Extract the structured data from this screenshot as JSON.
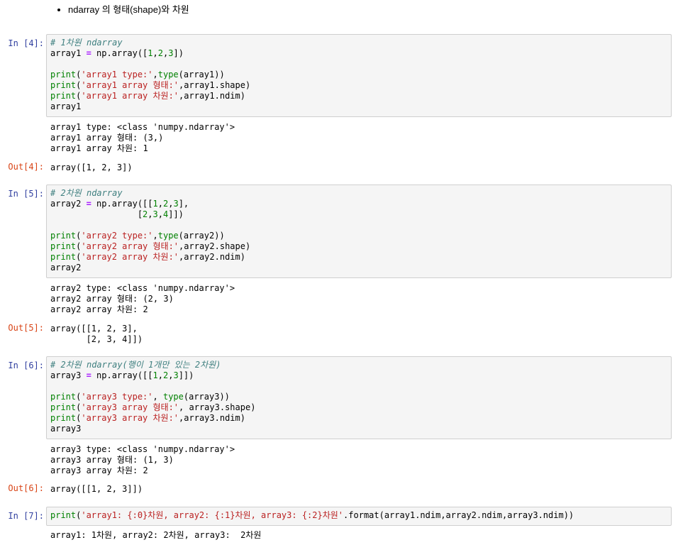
{
  "markdown": {
    "bullet": "ndarray 의 형태(shape)와 차원"
  },
  "cells": {
    "c4": {
      "in_prompt": "In [4]:",
      "out_prompt": "Out[4]:",
      "code": {
        "l1": "# 1차원 ndarray",
        "l2a": "array1 ",
        "l2b": "=",
        "l2c": " np.array([",
        "l2d": "1",
        "l2e": ",",
        "l2f": "2",
        "l2g": ",",
        "l2h": "3",
        "l2i": "])",
        "l4a": "print",
        "l4b": "(",
        "l4c": "'array1 type:'",
        "l4d": ",",
        "l4e": "type",
        "l4f": "(array1))",
        "l5a": "print",
        "l5b": "(",
        "l5c": "'array1 array 형태:'",
        "l5d": ",array1.shape)",
        "l6a": "print",
        "l6b": "(",
        "l6c": "'array1 array 차원:'",
        "l6d": ",array1.ndim)",
        "l7": "array1"
      },
      "stdout": [
        "array1 type: <class 'numpy.ndarray'>",
        "array1 array 형태: (3,)",
        "array1 array 차원: 1"
      ],
      "result": [
        "array([1, 2, 3])"
      ]
    },
    "c5": {
      "in_prompt": "In [5]:",
      "out_prompt": "Out[5]:",
      "code": {
        "l1": "# 2차원 ndarray",
        "l2a": "array2 ",
        "l2b": "=",
        "l2c": " np.array([[",
        "l2d": "1",
        "l2e": ",",
        "l2f": "2",
        "l2g": ",",
        "l2h": "3",
        "l2i": "],",
        "l3a": "                 [",
        "l3b": "2",
        "l3c": ",",
        "l3d": "3",
        "l3e": ",",
        "l3f": "4",
        "l3g": "]])",
        "l5a": "print",
        "l5b": "(",
        "l5c": "'array2 type:'",
        "l5d": ",",
        "l5e": "type",
        "l5f": "(array2))",
        "l6a": "print",
        "l6b": "(",
        "l6c": "'array2 array 형태:'",
        "l6d": ",array2.shape)",
        "l7a": "print",
        "l7b": "(",
        "l7c": "'array2 array 차원:'",
        "l7d": ",array2.ndim)",
        "l8": "array2"
      },
      "stdout": [
        "array2 type: <class 'numpy.ndarray'>",
        "array2 array 형태: (2, 3)",
        "array2 array 차원: 2"
      ],
      "result": [
        "array([[1, 2, 3],",
        "       [2, 3, 4]])"
      ]
    },
    "c6": {
      "in_prompt": "In [6]:",
      "out_prompt": "Out[6]:",
      "code": {
        "l1": "# 2차원 ndarray(행이 1개만 있는 2차원)",
        "l2a": "array3 ",
        "l2b": "=",
        "l2c": " np.array([[",
        "l2d": "1",
        "l2e": ",",
        "l2f": "2",
        "l2g": ",",
        "l2h": "3",
        "l2i": "]])",
        "l4a": "print",
        "l4b": "(",
        "l4c": "'array3 type:'",
        "l4d": ", ",
        "l4e": "type",
        "l4f": "(array3))",
        "l5a": "print",
        "l5b": "(",
        "l5c": "'array3 array 형태:'",
        "l5d": ", array3.shape)",
        "l6a": "print",
        "l6b": "(",
        "l6c": "'array3 array 차원:'",
        "l6d": ",array3.ndim)",
        "l7": "array3"
      },
      "stdout": [
        "array3 type: <class 'numpy.ndarray'>",
        "array3 array 형태: (1, 3)",
        "array3 array 차원: 2"
      ],
      "result": [
        "array([[1, 2, 3]])"
      ]
    },
    "c7": {
      "in_prompt": "In [7]:",
      "code": {
        "l1a": "print",
        "l1b": "(",
        "l1c": "'array1: {:0}차원, array2: {:1}차원, array3: {:2}차원'",
        "l1d": ".format(array1.ndim,array2.ndim,array3.ndim))"
      },
      "stdout": [
        "array1: 1차원, array2: 2차원, array3:  2차원"
      ]
    }
  }
}
